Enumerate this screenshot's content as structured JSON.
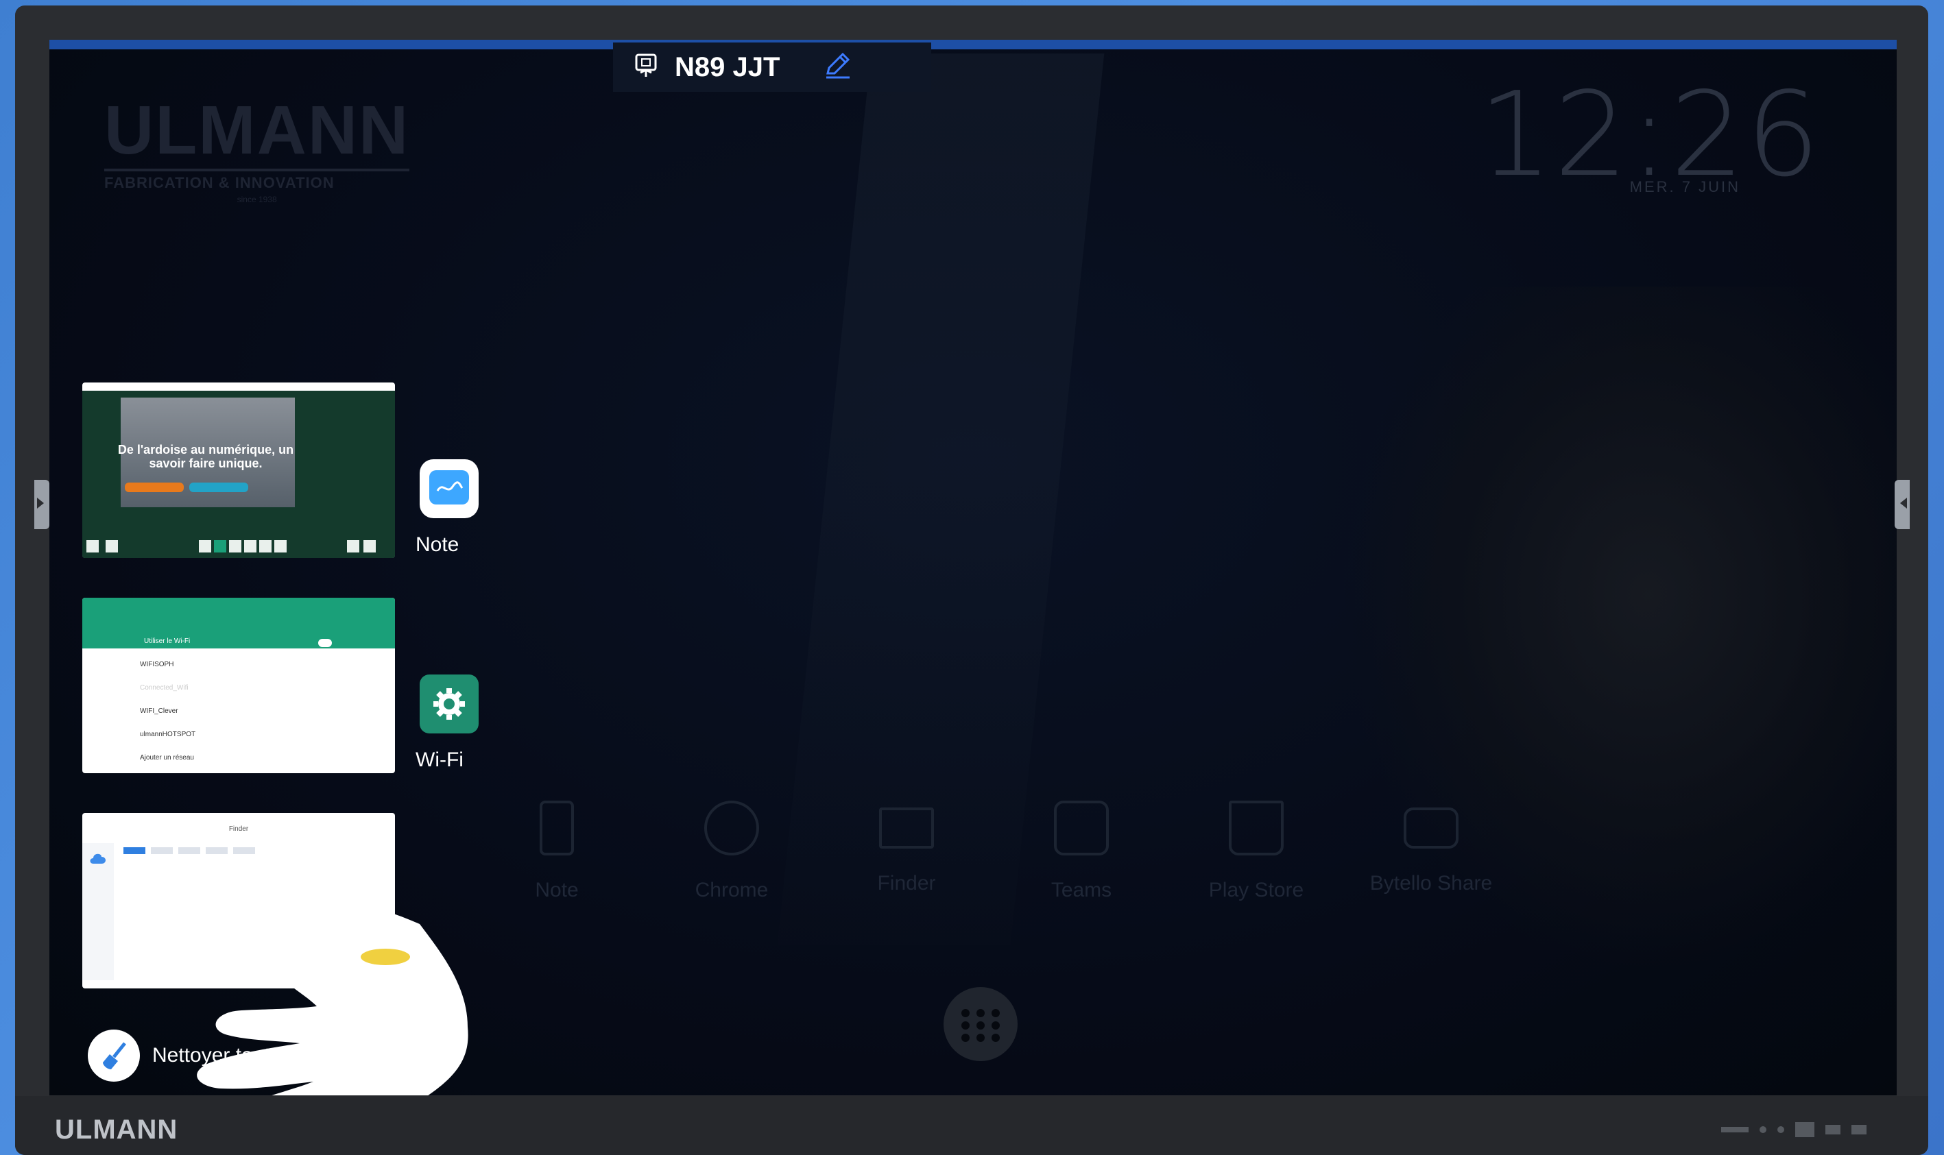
{
  "device": {
    "room_name": "N89 JJT",
    "bezel_brand": "ULMANN"
  },
  "home": {
    "clock": "12:26",
    "date": "MER. 7 JUIN",
    "logo": {
      "title": "ULMANN",
      "subtitle": "FABRICATION & INNOVATION",
      "tiny": "since 1938"
    }
  },
  "recents": {
    "apps": [
      {
        "name": "Note",
        "icon": "note-icon"
      },
      {
        "name": "Wi-Fi",
        "icon": "gear-icon"
      },
      {
        "name": "Finder",
        "icon": "finder-icon"
      }
    ],
    "card1_text": "De l'ardoise au numérique, un savoir faire unique.",
    "card2": {
      "title": "Utiliser le Wi-Fi",
      "networks": [
        "WIFISOPH",
        "Connected_Wifi",
        "WIFI_Clever",
        "ulmannHOTSPOT",
        "Ajouter un réseau"
      ]
    },
    "card3_title": "Finder",
    "clear_all_label": "Nettoyer toutes les"
  },
  "dock": {
    "items": [
      {
        "label": "Note",
        "icon": "note-icon"
      },
      {
        "label": "Chrome",
        "icon": "chrome-icon"
      },
      {
        "label": "Finder",
        "icon": "folder-icon"
      },
      {
        "label": "Teams",
        "icon": "teams-icon"
      },
      {
        "label": "Play Store",
        "icon": "store-icon"
      },
      {
        "label": "Bytello Share",
        "icon": "share-icon"
      }
    ]
  },
  "colors": {
    "accent_blue": "#3da7ff",
    "wifi_green": "#1f8e70",
    "screen_bg": "#060b18"
  }
}
